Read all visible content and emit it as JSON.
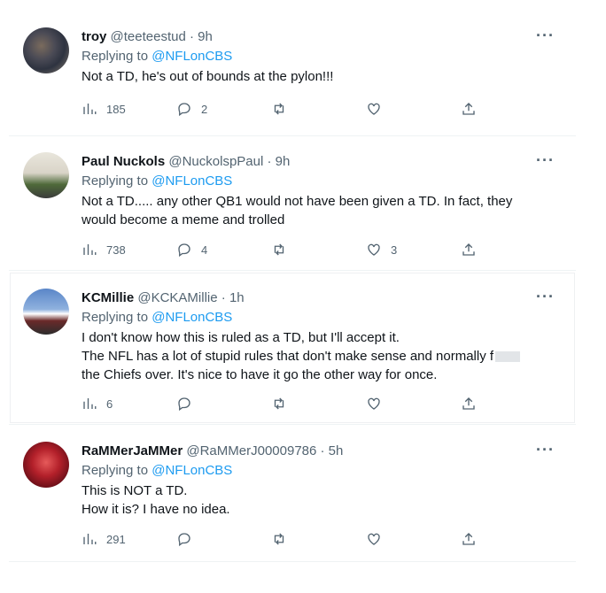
{
  "tweets": [
    {
      "name": "troy",
      "handle": "@teeteestud",
      "time": "· 9h",
      "replying_prefix": "Replying to",
      "replying_handle": "@NFLonCBS",
      "text_lines": [
        "Not a TD, he's out of bounds at the pylon!!!"
      ],
      "stats": {
        "views": "185",
        "replies": "2",
        "retweets": "",
        "likes": ""
      }
    },
    {
      "name": "Paul Nuckols",
      "handle": "@NuckolspPaul",
      "time": "· 9h",
      "replying_prefix": "Replying to",
      "replying_handle": "@NFLonCBS",
      "text_lines": [
        "Not a TD..... any other QB1 would not have been given a TD. In fact, they",
        "would become a meme and trolled"
      ],
      "stats": {
        "views": "738",
        "replies": "4",
        "retweets": "",
        "likes": "3"
      }
    },
    {
      "name": "KCMillie",
      "handle": "@KCKAMillie",
      "time": "· 1h",
      "replying_prefix": "Replying to",
      "replying_handle": "@NFLonCBS",
      "text_lines": [
        "I don't know how this is ruled as a TD, but I'll accept it.",
        "The NFL has a lot of stupid rules that don't make sense and normally f",
        "the Chiefs over. It's nice to have it go the other way for once."
      ],
      "stats": {
        "views": "6",
        "replies": "",
        "retweets": "",
        "likes": ""
      }
    },
    {
      "name": "RaMMerJaMMer",
      "handle": "@RaMMerJ00009786",
      "time": "· 5h",
      "replying_prefix": "Replying to",
      "replying_handle": "@NFLonCBS",
      "text_lines": [
        "This is NOT a TD.",
        "How it is? I have no idea."
      ],
      "stats": {
        "views": "291",
        "replies": "",
        "retweets": "",
        "likes": ""
      }
    }
  ],
  "more_icon": "more-horizontal-icon",
  "icons": [
    "views-icon",
    "reply-icon",
    "retweet-icon",
    "like-icon",
    "share-icon"
  ],
  "colors": {
    "link": "#1d9bf0",
    "muted": "#536471",
    "text": "#0f1419"
  }
}
